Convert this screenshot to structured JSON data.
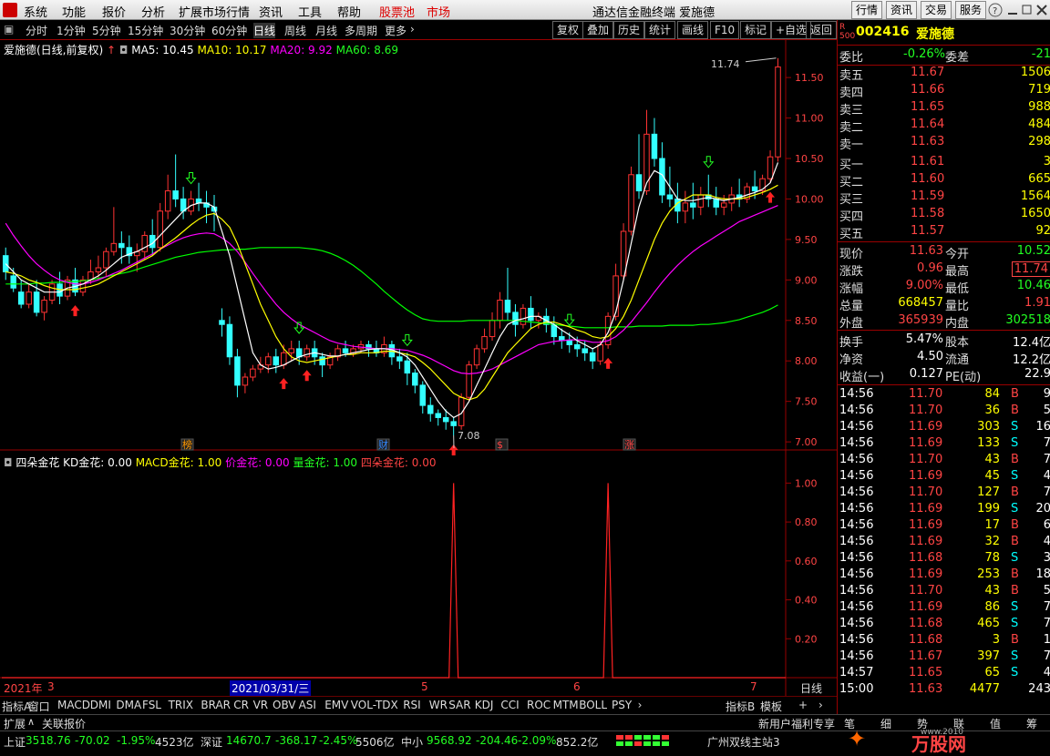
{
  "menu": {
    "items": [
      "系统",
      "功能",
      "报价",
      "分析",
      "扩展市场行情",
      "资讯",
      "工具",
      "帮助"
    ],
    "hl1": "股票池",
    "hl2": "市场",
    "title": "通达信金融终端  爱施德",
    "right_buttons": [
      "行情",
      "资讯",
      "交易",
      "服务"
    ]
  },
  "toolbar": {
    "periods": [
      "分时",
      "1分钟",
      "5分钟",
      "15分钟",
      "30分钟",
      "60分钟",
      "日线",
      "周线",
      "月线",
      "多周期",
      "更多"
    ],
    "selected": "日线",
    "right": [
      "复权",
      "叠加",
      "历史",
      "统计",
      "画线",
      "F10",
      "标记",
      "+自选",
      "返回"
    ]
  },
  "kline": {
    "title": "爱施德(日线,前复权)",
    "ma5": "MA5: 10.45",
    "ma10": "MA10: 10.17",
    "ma20": "MA20: 9.92",
    "ma60": "MA60: 8.69",
    "high_label": "11.74",
    "low_label": "7.08",
    "yticks": [
      "11.50",
      "11.00",
      "10.50",
      "10.00",
      "9.50",
      "9.00",
      "8.50",
      "8.00",
      "7.50",
      "7.00"
    ],
    "markers": [
      "榜",
      "财",
      "$",
      "涨"
    ]
  },
  "indicator": {
    "name": "四朵金花",
    "kd": "KD金花: 0.00",
    "macd": "MACD金花: 1.00",
    "price": "价金花: 0.00",
    "vol": "量金花: 1.00",
    "flower": "四朵金花: 0.00",
    "yticks": [
      "1.00",
      "0.80",
      "0.60",
      "0.40",
      "0.20"
    ]
  },
  "xaxis": {
    "labels": [
      "2021年",
      "3",
      "5",
      "6",
      "7"
    ],
    "cursor_date": "2021/03/31/三",
    "period": "日线"
  },
  "quote": {
    "code": "002416",
    "name": "爱施德",
    "weibi_label": "委比",
    "weibi": "-0.26%",
    "weicha_label": "委差",
    "weicha": "-21",
    "asks": [
      {
        "l": "卖五",
        "p": "11.67",
        "v": "1506"
      },
      {
        "l": "卖四",
        "p": "11.66",
        "v": "719"
      },
      {
        "l": "卖三",
        "p": "11.65",
        "v": "988"
      },
      {
        "l": "卖二",
        "p": "11.64",
        "v": "484"
      },
      {
        "l": "卖一",
        "p": "11.63",
        "v": "298"
      }
    ],
    "bids": [
      {
        "l": "买一",
        "p": "11.61",
        "v": "3"
      },
      {
        "l": "买二",
        "p": "11.60",
        "v": "665"
      },
      {
        "l": "买三",
        "p": "11.59",
        "v": "1564"
      },
      {
        "l": "买四",
        "p": "11.58",
        "v": "1650"
      },
      {
        "l": "买五",
        "p": "11.57",
        "v": "92"
      }
    ],
    "stats": [
      [
        "现价",
        "11.63",
        "今开",
        "10.52"
      ],
      [
        "涨跌",
        "0.96",
        "最高",
        "11.74"
      ],
      [
        "涨幅",
        "9.00%",
        "最低",
        "10.46"
      ],
      [
        "总量",
        "668457",
        "量比",
        "1.91"
      ],
      [
        "外盘",
        "365939",
        "内盘",
        "302518"
      ]
    ],
    "stats2": [
      [
        "换手",
        "5.47%",
        "股本",
        "12.4亿"
      ],
      [
        "净资",
        "4.50",
        "流通",
        "12.2亿"
      ],
      [
        "收益(一)",
        "0.127",
        "PE(动)",
        "22.9"
      ]
    ],
    "ticks": [
      [
        "14:56",
        "11.70",
        "84",
        "B",
        "9"
      ],
      [
        "14:56",
        "11.70",
        "36",
        "B",
        "5"
      ],
      [
        "14:56",
        "11.69",
        "303",
        "S",
        "16"
      ],
      [
        "14:56",
        "11.69",
        "133",
        "S",
        "7"
      ],
      [
        "14:56",
        "11.70",
        "43",
        "B",
        "7"
      ],
      [
        "14:56",
        "11.69",
        "45",
        "S",
        "4"
      ],
      [
        "14:56",
        "11.70",
        "127",
        "B",
        "7"
      ],
      [
        "14:56",
        "11.69",
        "199",
        "S",
        "20"
      ],
      [
        "14:56",
        "11.69",
        "17",
        "B",
        "6"
      ],
      [
        "14:56",
        "11.69",
        "32",
        "B",
        "4"
      ],
      [
        "14:56",
        "11.68",
        "78",
        "S",
        "3"
      ],
      [
        "14:56",
        "11.69",
        "253",
        "B",
        "18"
      ],
      [
        "14:56",
        "11.70",
        "43",
        "B",
        "5"
      ],
      [
        "14:56",
        "11.69",
        "86",
        "S",
        "7"
      ],
      [
        "14:56",
        "11.68",
        "465",
        "S",
        "7"
      ],
      [
        "14:56",
        "11.68",
        "3",
        "B",
        "1"
      ],
      [
        "14:56",
        "11.67",
        "397",
        "S",
        "7"
      ],
      [
        "14:57",
        "11.65",
        "65",
        "S",
        "4"
      ],
      [
        "15:00",
        "11.63",
        "4477",
        "",
        "243"
      ]
    ]
  },
  "tabs": [
    "指标A",
    "窗口",
    "MACD",
    "DMI",
    "DMA",
    "FSL",
    "TRIX",
    "BRAR",
    "CR",
    "VR",
    "OBV",
    "ASI",
    "EMV",
    "VOL-TDX",
    "RSI",
    "WR",
    "SAR",
    "KDJ",
    "CCI",
    "ROC",
    "MTM",
    "BOLL",
    "PSY"
  ],
  "tabs_right": [
    "指标B",
    "模板"
  ],
  "row2": {
    "left": [
      "扩展",
      "关联报价"
    ],
    "right": "新用户福利专享",
    "rtabs": [
      "笔",
      "细",
      "势",
      "联",
      "值",
      "筹"
    ]
  },
  "status": {
    "sh": "上证",
    "sh_v": "3518.76",
    "sh_c": "-70.02",
    "sh_p": "-1.95%",
    "sh_a": "4523亿",
    "sz": "深证",
    "sz_v": "14670.7",
    "sz_c": "-368.17",
    "sz_p": "-2.45%",
    "sz_a": "5506亿",
    "zx": "中小",
    "zx_v": "9568.92",
    "zx_c": "-204.46",
    "zx_p": "-2.09%",
    "zx_a": "852.2亿",
    "server": "广州双线主站3",
    "brand": "万股网",
    "url": "www.2010"
  },
  "colors": {
    "up": "#ff3333",
    "down": "#33ffff",
    "ma5": "#ffffff",
    "ma10": "#ffff00",
    "ma20": "#ff00ff",
    "ma60": "#00ff00"
  },
  "chart_data": {
    "type": "candlestick",
    "price_ylim": [
      6.9,
      11.85
    ],
    "candles": [
      [
        9.3,
        9.4,
        9.1,
        9.0
      ],
      [
        9.05,
        9.15,
        8.9,
        8.85
      ],
      [
        8.85,
        9.0,
        8.7,
        8.65
      ],
      [
        8.7,
        8.95,
        8.85,
        8.65
      ],
      [
        8.85,
        9.0,
        8.6,
        8.55
      ],
      [
        8.6,
        8.8,
        8.75,
        8.5
      ],
      [
        8.75,
        9.0,
        8.95,
        8.7
      ],
      [
        8.95,
        9.1,
        8.8,
        8.7
      ],
      [
        8.8,
        9.05,
        9.0,
        8.75
      ],
      [
        9.0,
        9.15,
        8.85,
        8.8
      ],
      [
        8.85,
        9.05,
        9.0,
        8.8
      ],
      [
        9.0,
        9.25,
        9.1,
        8.95
      ],
      [
        9.1,
        9.3,
        9.15,
        9.0
      ],
      [
        9.15,
        9.4,
        9.35,
        9.05
      ],
      [
        9.35,
        9.9,
        9.45,
        9.3
      ],
      [
        9.45,
        9.6,
        9.4,
        9.2
      ],
      [
        9.4,
        9.55,
        9.3,
        9.2
      ],
      [
        9.3,
        9.45,
        9.35,
        9.1
      ],
      [
        9.35,
        9.6,
        9.55,
        9.25
      ],
      [
        9.55,
        9.75,
        9.4,
        9.3
      ],
      [
        9.4,
        9.95,
        9.85,
        9.35
      ],
      [
        9.85,
        10.3,
        10.1,
        9.75
      ],
      [
        10.1,
        10.55,
        10.0,
        9.9
      ],
      [
        10.0,
        10.15,
        9.85,
        9.75
      ],
      [
        9.85,
        10.1,
        10.0,
        9.8
      ],
      [
        10.0,
        10.2,
        9.95,
        9.85
      ],
      [
        9.95,
        10.1,
        9.9,
        9.7
      ],
      [
        9.9,
        10.05,
        9.85,
        9.6
      ],
      [
        8.5,
        8.65,
        8.45,
        8.3
      ],
      [
        8.45,
        8.55,
        8.05,
        7.95
      ],
      [
        8.05,
        8.15,
        7.7,
        7.55
      ],
      [
        7.7,
        7.85,
        7.8,
        7.6
      ],
      [
        7.8,
        7.95,
        7.9,
        7.75
      ],
      [
        7.9,
        8.05,
        7.95,
        7.85
      ],
      [
        7.95,
        8.1,
        8.05,
        7.85
      ],
      [
        8.05,
        8.15,
        7.95,
        7.85
      ],
      [
        7.95,
        8.2,
        8.1,
        7.9
      ],
      [
        8.1,
        8.25,
        8.15,
        8.0
      ],
      [
        8.15,
        8.25,
        8.05,
        7.95
      ],
      [
        8.05,
        8.2,
        8.15,
        8.0
      ],
      [
        8.15,
        8.25,
        8.05,
        7.95
      ],
      [
        8.05,
        8.1,
        7.95,
        7.8
      ],
      [
        7.95,
        8.1,
        8.05,
        7.9
      ],
      [
        8.05,
        8.2,
        8.15,
        8.0
      ],
      [
        8.15,
        8.25,
        8.1,
        8.05
      ],
      [
        8.1,
        8.2,
        8.15,
        8.05
      ],
      [
        8.15,
        8.25,
        8.2,
        8.1
      ],
      [
        8.2,
        8.25,
        8.15,
        8.05
      ],
      [
        8.15,
        8.25,
        8.1,
        8.05
      ],
      [
        8.1,
        8.3,
        8.2,
        8.05
      ],
      [
        8.2,
        8.25,
        8.05,
        7.95
      ],
      [
        8.05,
        8.15,
        8.0,
        7.9
      ],
      [
        8.0,
        8.1,
        7.85,
        7.7
      ],
      [
        7.85,
        7.9,
        7.7,
        7.6
      ],
      [
        7.7,
        7.75,
        7.45,
        7.35
      ],
      [
        7.45,
        7.55,
        7.35,
        7.25
      ],
      [
        7.35,
        7.4,
        7.3,
        7.2
      ],
      [
        7.3,
        7.4,
        7.25,
        7.15
      ],
      [
        7.25,
        7.3,
        7.2,
        7.08
      ],
      [
        7.2,
        7.6,
        7.55,
        7.15
      ],
      [
        7.55,
        8.0,
        7.95,
        7.5
      ],
      [
        7.95,
        8.2,
        8.15,
        7.9
      ],
      [
        8.15,
        8.4,
        8.3,
        8.1
      ],
      [
        8.3,
        8.6,
        8.5,
        8.25
      ],
      [
        8.5,
        8.85,
        8.75,
        8.4
      ],
      [
        8.75,
        9.15,
        8.6,
        8.5
      ],
      [
        8.6,
        8.7,
        8.45,
        8.3
      ],
      [
        8.45,
        8.7,
        8.65,
        8.4
      ],
      [
        8.65,
        8.8,
        8.5,
        8.4
      ],
      [
        8.5,
        8.6,
        8.55,
        8.4
      ],
      [
        8.55,
        8.65,
        8.45,
        8.35
      ],
      [
        8.45,
        8.55,
        8.3,
        8.2
      ],
      [
        8.3,
        8.4,
        8.25,
        8.15
      ],
      [
        8.25,
        8.35,
        8.2,
        8.1
      ],
      [
        8.2,
        8.3,
        8.15,
        8.05
      ],
      [
        8.15,
        8.25,
        8.1,
        8.0
      ],
      [
        8.1,
        8.15,
        8.0,
        7.9
      ],
      [
        8.0,
        8.25,
        8.2,
        7.95
      ],
      [
        8.2,
        8.6,
        8.55,
        8.15
      ],
      [
        8.55,
        9.2,
        9.05,
        8.5
      ],
      [
        9.05,
        9.7,
        9.6,
        9.0
      ],
      [
        9.6,
        10.4,
        10.3,
        9.55
      ],
      [
        10.3,
        10.8,
        10.1,
        10.0
      ],
      [
        10.1,
        11.1,
        10.8,
        10.05
      ],
      [
        10.8,
        11.0,
        10.5,
        10.4
      ],
      [
        10.5,
        10.7,
        10.05,
        9.95
      ],
      [
        10.05,
        10.4,
        10.0,
        9.9
      ],
      [
        10.0,
        10.2,
        9.85,
        9.7
      ],
      [
        9.85,
        10.1,
        9.95,
        9.7
      ],
      [
        9.95,
        10.2,
        9.9,
        9.75
      ],
      [
        9.9,
        10.15,
        10.05,
        9.8
      ],
      [
        10.05,
        10.3,
        10.0,
        9.9
      ],
      [
        10.0,
        10.15,
        9.9,
        9.8
      ],
      [
        9.9,
        10.05,
        9.95,
        9.8
      ],
      [
        9.95,
        10.15,
        10.05,
        9.85
      ],
      [
        10.05,
        10.25,
        10.0,
        9.9
      ],
      [
        10.0,
        10.2,
        10.15,
        9.95
      ],
      [
        10.15,
        10.35,
        10.1,
        10.0
      ],
      [
        10.1,
        10.3,
        10.25,
        10.05
      ],
      [
        10.25,
        10.6,
        10.52,
        10.2
      ],
      [
        10.52,
        11.74,
        11.63,
        10.46
      ]
    ],
    "ma5": [
      9.2,
      9.1,
      9.0,
      8.95,
      8.9,
      8.85,
      8.85,
      8.85,
      8.9,
      8.92,
      8.95,
      9.0,
      9.05,
      9.12,
      9.2,
      9.28,
      9.32,
      9.35,
      9.4,
      9.45,
      9.55,
      9.65,
      9.75,
      9.85,
      9.92,
      9.95,
      9.95,
      9.9,
      9.6,
      9.3,
      8.9,
      8.5,
      8.1,
      7.95,
      7.9,
      7.92,
      7.95,
      8.0,
      8.05,
      8.08,
      8.1,
      8.08,
      8.06,
      8.06,
      8.08,
      8.1,
      8.12,
      8.14,
      8.15,
      8.15,
      8.14,
      8.1,
      8.05,
      7.95,
      7.8,
      7.65,
      7.5,
      7.38,
      7.3,
      7.35,
      7.5,
      7.7,
      7.9,
      8.1,
      8.3,
      8.45,
      8.5,
      8.52,
      8.55,
      8.55,
      8.5,
      8.45,
      8.38,
      8.32,
      8.25,
      8.2,
      8.15,
      8.2,
      8.35,
      8.6,
      9.0,
      9.45,
      9.9,
      10.2,
      10.35,
      10.3,
      10.15,
      10.0,
      9.98,
      9.98,
      10.0,
      10.02,
      10.0,
      9.98,
      10.0,
      10.02,
      10.05,
      10.08,
      10.12,
      10.2,
      10.45
    ],
    "ma10": [
      9.1,
      9.08,
      9.05,
      9.0,
      8.97,
      8.93,
      8.9,
      8.88,
      8.88,
      8.88,
      8.9,
      8.92,
      8.95,
      9.0,
      9.05,
      9.1,
      9.15,
      9.2,
      9.25,
      9.3,
      9.38,
      9.45,
      9.52,
      9.6,
      9.68,
      9.75,
      9.8,
      9.82,
      9.75,
      9.65,
      9.45,
      9.2,
      8.95,
      8.7,
      8.5,
      8.3,
      8.15,
      8.05,
      8.0,
      7.98,
      8.0,
      8.02,
      8.04,
      8.06,
      8.08,
      8.08,
      8.1,
      8.1,
      8.1,
      8.12,
      8.12,
      8.1,
      8.08,
      8.05,
      7.98,
      7.9,
      7.8,
      7.7,
      7.6,
      7.55,
      7.52,
      7.55,
      7.65,
      7.8,
      7.95,
      8.1,
      8.2,
      8.3,
      8.4,
      8.45,
      8.48,
      8.48,
      8.45,
      8.42,
      8.38,
      8.35,
      8.3,
      8.28,
      8.3,
      8.4,
      8.55,
      8.75,
      9.0,
      9.25,
      9.5,
      9.7,
      9.85,
      9.95,
      10.0,
      10.05,
      10.05,
      10.05,
      10.02,
      10.0,
      10.0,
      10.0,
      10.02,
      10.05,
      10.08,
      10.12,
      10.17
    ],
    "ma20": [
      9.7,
      9.55,
      9.42,
      9.3,
      9.2,
      9.12,
      9.05,
      9.0,
      8.97,
      8.95,
      8.95,
      8.97,
      9.0,
      9.04,
      9.08,
      9.12,
      9.17,
      9.22,
      9.27,
      9.32,
      9.38,
      9.43,
      9.48,
      9.52,
      9.55,
      9.57,
      9.58,
      9.57,
      9.52,
      9.45,
      9.35,
      9.22,
      9.08,
      8.95,
      8.82,
      8.7,
      8.6,
      8.52,
      8.45,
      8.4,
      8.35,
      8.3,
      8.25,
      8.22,
      8.2,
      8.18,
      8.17,
      8.16,
      8.15,
      8.15,
      8.15,
      8.14,
      8.13,
      8.1,
      8.07,
      8.03,
      7.98,
      7.93,
      7.88,
      7.85,
      7.84,
      7.85,
      7.87,
      7.9,
      7.95,
      8.0,
      8.05,
      8.1,
      8.15,
      8.2,
      8.22,
      8.24,
      8.25,
      8.26,
      8.26,
      8.25,
      8.23,
      8.23,
      8.25,
      8.3,
      8.38,
      8.48,
      8.6,
      8.72,
      8.85,
      8.97,
      9.08,
      9.18,
      9.27,
      9.35,
      9.42,
      9.48,
      9.54,
      9.6,
      9.66,
      9.72,
      9.76,
      9.8,
      9.84,
      9.88,
      9.92
    ],
    "ma60": [
      8.95,
      8.95,
      8.95,
      8.95,
      8.96,
      8.96,
      8.97,
      8.97,
      8.98,
      8.98,
      8.99,
      9.0,
      9.02,
      9.04,
      9.06,
      9.08,
      9.1,
      9.13,
      9.16,
      9.19,
      9.22,
      9.25,
      9.28,
      9.3,
      9.32,
      9.34,
      9.35,
      9.36,
      9.37,
      9.37,
      9.38,
      9.38,
      9.39,
      9.4,
      9.4,
      9.4,
      9.4,
      9.4,
      9.4,
      9.39,
      9.38,
      9.36,
      9.33,
      9.29,
      9.24,
      9.18,
      9.11,
      9.03,
      8.95,
      8.86,
      8.78,
      8.7,
      8.63,
      8.57,
      8.52,
      8.5,
      8.49,
      8.49,
      8.49,
      8.49,
      8.5,
      8.5,
      8.5,
      8.5,
      8.5,
      8.5,
      8.5,
      8.49,
      8.48,
      8.47,
      8.46,
      8.45,
      8.44,
      8.43,
      8.42,
      8.41,
      8.41,
      8.41,
      8.41,
      8.42,
      8.42,
      8.42,
      8.43,
      8.43,
      8.43,
      8.43,
      8.44,
      8.44,
      8.44,
      8.44,
      8.45,
      8.45,
      8.46,
      8.47,
      8.49,
      8.51,
      8.54,
      8.57,
      8.6,
      8.64,
      8.69
    ],
    "up_arrows": [
      9,
      36,
      39,
      58,
      78,
      99
    ],
    "down_arrows": [
      24,
      38,
      52,
      73,
      91
    ],
    "indicator_ylim": [
      0,
      1.1
    ],
    "indicator_spikes": [
      58,
      78
    ]
  }
}
